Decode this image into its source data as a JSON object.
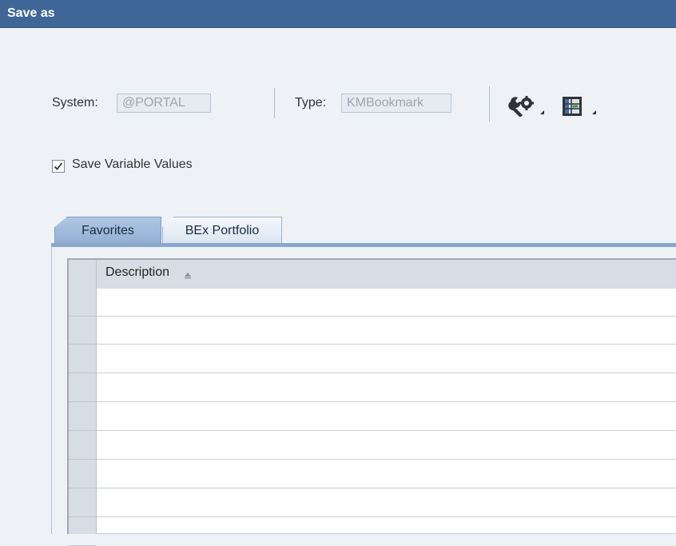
{
  "window": {
    "title": "Save as"
  },
  "system": {
    "label": "System:",
    "value": "@PORTAL"
  },
  "type": {
    "label": "Type:",
    "value": "KMBookmark"
  },
  "toolbar": {
    "settings_icon": "wrench-gear-icon",
    "layout_icon": "table-layout-icon"
  },
  "save_variable_values": {
    "label": "Save Variable Values",
    "checked": true
  },
  "tabs": [
    {
      "label": "Favorites",
      "active": true
    },
    {
      "label": "BEx Portfolio",
      "active": false
    }
  ],
  "table": {
    "columns": [
      {
        "label": "Description",
        "sort": "ascending"
      }
    ],
    "rows": [
      "",
      "",
      "",
      "",
      "",
      "",
      "",
      "",
      ""
    ]
  }
}
